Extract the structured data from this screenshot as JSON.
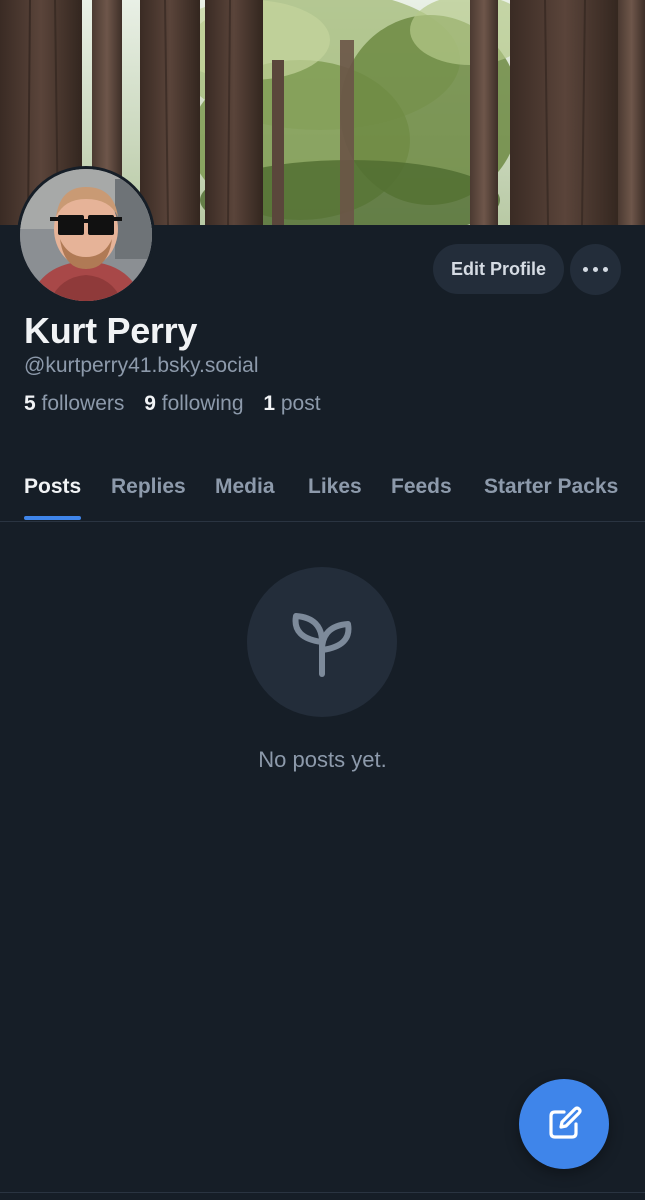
{
  "profile": {
    "display_name": "Kurt Perry",
    "handle": "@kurtperry41.bsky.social",
    "banner_icon": "redwood-forest-banner",
    "avatar_icon": "user-avatar"
  },
  "actions": {
    "edit_profile_label": "Edit Profile",
    "more_icon": "ellipsis-icon"
  },
  "stats": {
    "followers_count": "5",
    "followers_label": "followers",
    "following_count": "9",
    "following_label": "following",
    "posts_count": "1",
    "posts_label": "post"
  },
  "tabs": [
    {
      "label": "Posts",
      "active": true
    },
    {
      "label": "Replies",
      "active": false
    },
    {
      "label": "Media",
      "active": false
    },
    {
      "label": "Likes",
      "active": false
    },
    {
      "label": "Feeds",
      "active": false
    },
    {
      "label": "Starter Packs",
      "active": false
    }
  ],
  "empty_state": {
    "icon": "sprout-icon",
    "message": "No posts yet."
  },
  "compose": {
    "icon": "compose-icon"
  },
  "colors": {
    "background": "#161e27",
    "surface": "#232d3a",
    "accent": "#3f85ea",
    "text_primary": "#f1f3f5",
    "text_secondary": "#8d9aab"
  }
}
